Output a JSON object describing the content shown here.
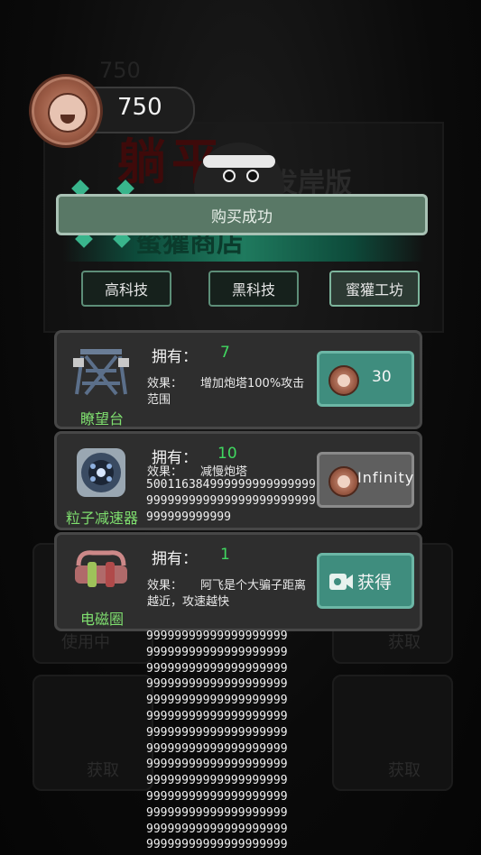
{
  "coins": {
    "value": "750",
    "ghost_value": "750"
  },
  "background": {
    "title": "躺平",
    "subtitle": "发岸版",
    "shop_banner": "蜜獾商店",
    "tile_labels": [
      "使用中",
      "获取",
      "获取",
      "获取"
    ]
  },
  "toast": {
    "text": "购买成功"
  },
  "tabs": [
    {
      "label": "高科技",
      "active": false
    },
    {
      "label": "黑科技",
      "active": false
    },
    {
      "label": "蜜獾工坊",
      "active": true
    }
  ],
  "items": [
    {
      "name": "瞭望台",
      "owned_label": "拥有：",
      "owned": "7",
      "effect_label": "效果：",
      "effect": "增加炮塔100%攻击范围",
      "price": "30",
      "icon": "watchtower-icon"
    },
    {
      "name": "粒子减速器",
      "owned_label": "拥有：",
      "owned": "10",
      "effect_label": "效果：",
      "effect": "减慢炮塔",
      "effect_overflow": "500116384999999999999999999999999999999999999999999999999999",
      "price": "Infinity",
      "icon": "particle-decelerator-icon"
    },
    {
      "name": "电磁圈",
      "owned_label": "拥有：",
      "owned": "1",
      "effect_label": "效果：",
      "effect": "阿飞是个大骗子距离越近，攻速越快",
      "button": "获得",
      "icon": "electromagnetic-coil-icon"
    }
  ],
  "overflow_rows": [
    "99999999999999999999",
    "99999999999999999999",
    "99999999999999999999",
    "99999999999999999999",
    "99999999999999999999",
    "99999999999999999999",
    "99999999999999999999",
    "99999999999999999999",
    "99999999999999999999",
    "99999999999999999999",
    "99999999999999999999",
    "99999999999999999999",
    "99999999999999999999",
    "99999999999999999999"
  ]
}
